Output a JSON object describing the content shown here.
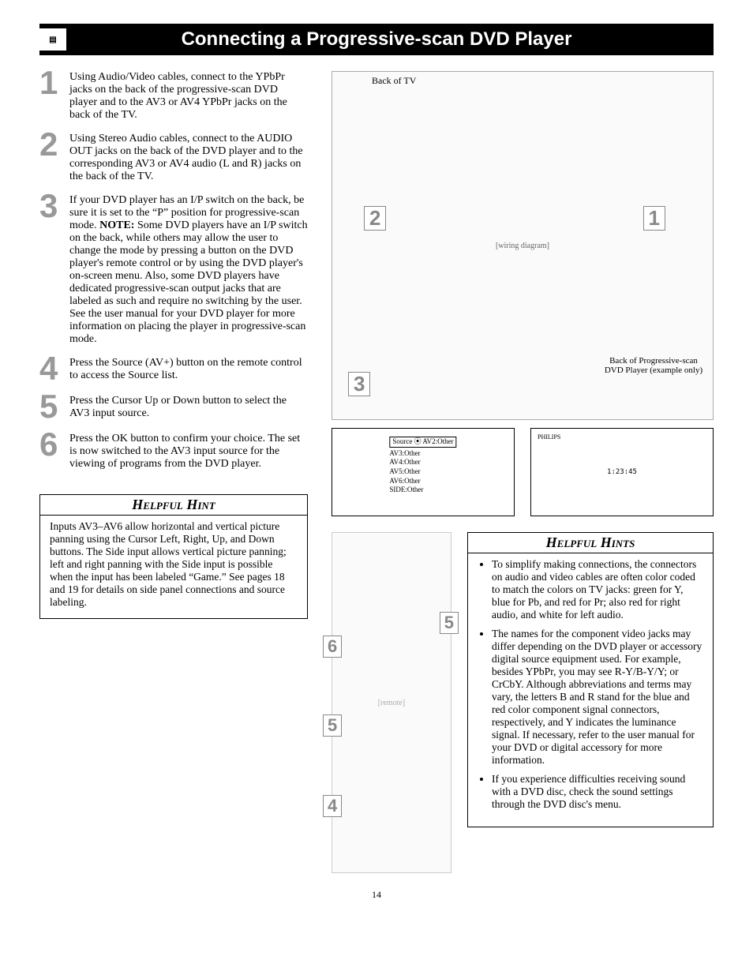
{
  "title": "Connecting a Progressive-scan DVD Player",
  "steps": [
    {
      "n": "1",
      "text": "Using Audio/Video cables, connect to the YPbPr jacks on the back of the progressive-scan DVD player and to the AV3 or AV4 YPbPr jacks on the back of the TV."
    },
    {
      "n": "2",
      "text": "Using Stereo Audio cables, connect to the AUDIO OUT jacks on the back of the DVD player and to the corresponding AV3 or AV4 audio (L and R) jacks on the back of the TV."
    },
    {
      "n": "3",
      "pre": "If your DVD player has an I/P switch on the back, be sure it is set to the “P” position for progressive-scan mode. ",
      "note": "NOTE:",
      "post": " Some DVD players have an I/P switch on the back, while others may allow the user to change the mode by pressing a button on the DVD player's remote control or by using the DVD player's on-screen menu. Also, some DVD players have dedicated progressive-scan output jacks that are labeled as such and require no switching by the user. See the user manual for your DVD player for more information on placing the player in progressive-scan mode."
    },
    {
      "n": "4",
      "text": "Press the Source (AV+) button on the remote control to access the Source list."
    },
    {
      "n": "5",
      "text": "Press the Cursor Up or Down button to select the AV3 input source."
    },
    {
      "n": "6",
      "text": "Press the OK button to confirm your choice. The set is now switched to the AV3 input source for the viewing of programs from the DVD player."
    }
  ],
  "diagram": {
    "top_label": "Back of TV",
    "callouts": {
      "c1": "1",
      "c2": "2",
      "c3": "3"
    },
    "bottom_label": "Back of Progressive-scan DVD Player (example only)",
    "placeholder": "[wiring diagram]"
  },
  "osd": {
    "source_label": "Source",
    "items": [
      "AV2:Other",
      "AV3:Other",
      "AV4:Other",
      "AV5:Other",
      "AV6:Other",
      "SIDE:Other"
    ],
    "time": "1:23:45",
    "brand": "PHILIPS"
  },
  "remote": {
    "callouts": {
      "r4": "4",
      "r5a": "5",
      "r5b": "5",
      "r6": "6"
    },
    "placeholder": "[remote]"
  },
  "hint_left": {
    "title": "Helpful Hint",
    "body": "Inputs AV3–AV6 allow horizontal and vertical picture panning using the Cursor Left, Right, Up, and Down buttons. The Side input allows vertical picture panning; left and right panning with the Side input is possible when the input has been labeled “Game.” See pages 18 and 19 for details on side panel connections and source labeling."
  },
  "hint_right": {
    "title": "Helpful Hints",
    "items": [
      "To simplify making connections, the connectors on audio and video cables are often color coded to match the colors on TV jacks: green for Y, blue for Pb, and red for Pr; also red for right audio, and white for left audio.",
      "The names for the component video jacks may differ depending on the DVD player or accessory digital source equipment used. For example, besides YPbPr, you may see R-Y/B-Y/Y; or CrCbY. Although abbreviations and terms may vary, the letters B and R stand for the blue and red color component signal connectors, respectively, and Y indicates the luminance signal. If necessary, refer to the user manual for your DVD or digital accessory for more information.",
      "If you experience difficulties receiving sound with a DVD disc, check the sound settings through the DVD disc's menu."
    ]
  },
  "page_number": "14"
}
